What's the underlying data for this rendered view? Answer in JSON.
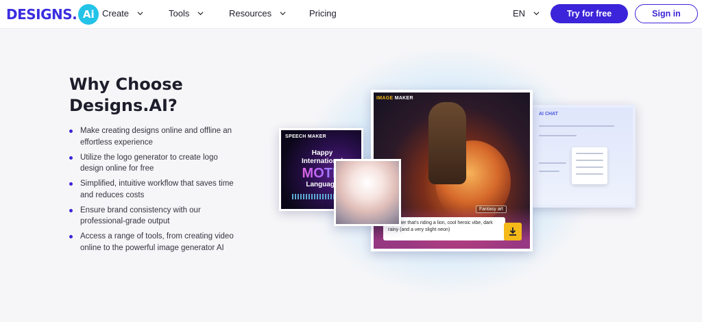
{
  "header": {
    "logo_text": "DESIGNS.",
    "logo_mark": "Ai",
    "nav": [
      {
        "label": "Create",
        "has_dropdown": true
      },
      {
        "label": "Tools",
        "has_dropdown": true
      },
      {
        "label": "Resources",
        "has_dropdown": true
      },
      {
        "label": "Pricing",
        "has_dropdown": false
      }
    ],
    "language": "EN",
    "try_button": "Try for free",
    "sign_in_button": "Sign in"
  },
  "hero": {
    "heading_line1": "Why Choose",
    "heading_line2": "Designs.AI?",
    "bullets": [
      "Make creating designs online and offline an effortless experience",
      "Utilize the logo generator to create logo design online for free",
      "Simplified, intuitive workflow that saves time and reduces costs",
      "Ensure brand consistency with our professional-grade output",
      "Access a range of tools, from creating video online to the powerful image generator AI"
    ]
  },
  "showcase": {
    "speech_maker": {
      "tag": "SPEECH MAKER",
      "line1": "Happy",
      "line2": "International",
      "line3": "MOTH",
      "line4": "Language"
    },
    "image_maker": {
      "tag_prefix": "IMAGE",
      "tag_suffix": " MAKER",
      "style_tag": "Fantasy art",
      "prompt": "a soldier that's riding a lion, cool heroic vibe, dark rainy (and a very slight neon)"
    },
    "ai_chat": {
      "tag": "AI CHAT"
    }
  },
  "colors": {
    "brand": "#3b24d9",
    "logo_accent": "#23c3e8",
    "download": "#f5b919"
  },
  "icons": {
    "chevron": "chevron-down-icon",
    "download": "download-icon"
  }
}
